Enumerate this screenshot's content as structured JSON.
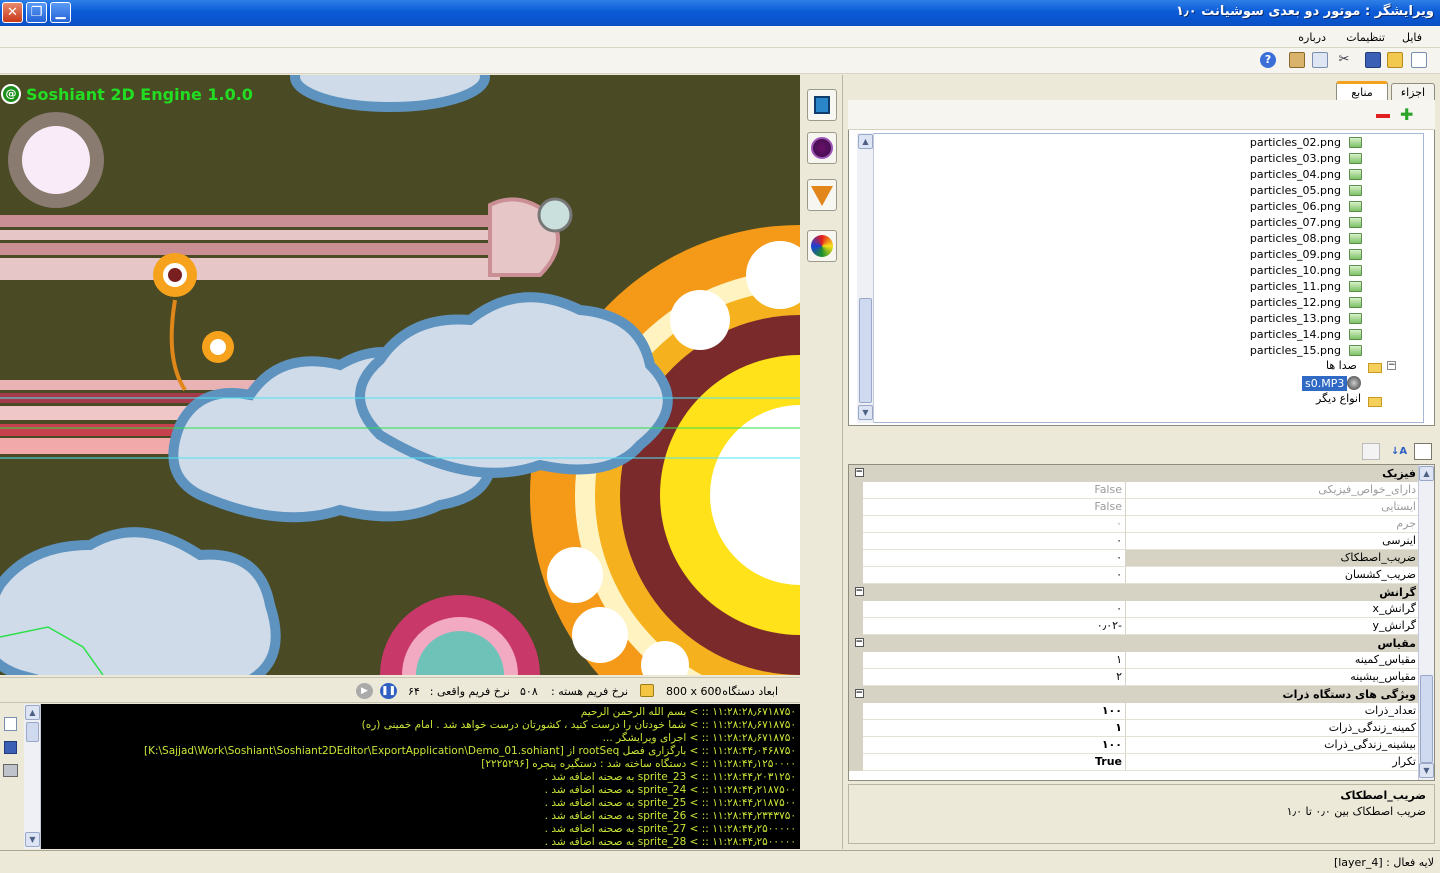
{
  "window": {
    "title": "ویرایشگر : موتور دو بعدی سوشیانت ۱٫۰",
    "close": "✕",
    "restore": "❐",
    "minimize": "▁"
  },
  "menu": {
    "items": [
      "فایل",
      "تنظیمات",
      "درباره"
    ]
  },
  "toolbar": {
    "icons": [
      "new-file-icon",
      "open-folder-icon",
      "save-icon",
      "cut-icon",
      "copy-icon",
      "paste-icon",
      "help-icon"
    ]
  },
  "viewport": {
    "engine_label": "Soshiant 2D Engine 1.0.0",
    "engine_badge": "@"
  },
  "viewport_status": {
    "device_dims_label": "ابعاد دستگاه :",
    "device_dims_value": "800 x 600",
    "core_rate_label": "نرخ فریم هسته :",
    "core_rate_value": "۵۰۸",
    "real_rate_label": "نرخ فریم واقعی :",
    "real_rate_value": "۶۴"
  },
  "console": {
    "lines": [
      {
        "ts": "۱۱:۲۸:۲۸٫۶۷۱۸۷۵۰",
        "msg": ":: > بسم الله الرحمن الرحیم"
      },
      {
        "ts": "۱۱:۲۸:۲۸٫۶۷۱۸۷۵۰",
        "msg": ":: > شما خودتان را درست کنید ، کشورتان درست خواهد شد . امام خمینی (ره)"
      },
      {
        "ts": "۱۱:۲۸:۲۸٫۶۷۱۸۷۵۰",
        "msg": ":: > اجرای ویرایشگر ..."
      },
      {
        "ts": "۱۱:۲۸:۴۴٫۰۴۶۸۷۵۰",
        "msg": ":: > بارگزاری فصل rootSeq از [K:\\Sajjad\\Work\\Soshiant\\Soshiant2DEditor\\ExportApplication\\Demo_01.sohiant]"
      },
      {
        "ts": "۱۱:۲۸:۴۴٫۱۲۵۰۰۰۰",
        "msg": ":: > دستگاه ساخته شد : دستگیره پنجره [۲۲۲۵۲۹۶]"
      },
      {
        "ts": "۱۱:۲۸:۴۴٫۲۰۳۱۲۵۰",
        "msg": ":: > sprite_23  به صحنه اضافه شد ."
      },
      {
        "ts": "۱۱:۲۸:۴۴٫۲۱۸۷۵۰۰",
        "msg": ":: > sprite_24  به صحنه اضافه شد ."
      },
      {
        "ts": "۱۱:۲۸:۴۴٫۲۱۸۷۵۰۰",
        "msg": ":: > sprite_25  به صحنه اضافه شد ."
      },
      {
        "ts": "۱۱:۲۸:۴۴٫۲۳۴۳۷۵۰",
        "msg": ":: > sprite_26  به صحنه اضافه شد ."
      },
      {
        "ts": "۱۱:۲۸:۴۴٫۲۵۰۰۰۰۰",
        "msg": ":: > sprite_27  به صحنه اضافه شد ."
      },
      {
        "ts": "۱۱:۲۸:۴۴٫۲۵۰۰۰۰۰",
        "msg": ":: > sprite_28  به صحنه اضافه شد ."
      }
    ]
  },
  "right_panel": {
    "tabs": [
      "اجزاء",
      "منابع"
    ],
    "tree": {
      "files": [
        "particles_02.png",
        "particles_03.png",
        "particles_04.png",
        "particles_05.png",
        "particles_06.png",
        "particles_07.png",
        "particles_08.png",
        "particles_09.png",
        "particles_10.png",
        "particles_11.png",
        "particles_12.png",
        "particles_13.png",
        "particles_14.png",
        "particles_15.png"
      ],
      "sounds_folder": "صدا ها",
      "sound_file": "s0.MP3",
      "others_folder": "انواع دیگر"
    },
    "properties": {
      "cat_physics": "فیزیک",
      "cat_gravity": "گرانش",
      "cat_scale": "مقیاس",
      "cat_emitter": "ویژگی های دستگاه ذرات",
      "rows": {
        "has_physics": {
          "name": "دارای_خواص_فیزیکی",
          "value": "False"
        },
        "static": {
          "name": "ایستایی",
          "value": "False"
        },
        "mass": {
          "name": "جرم",
          "value": "۰"
        },
        "inertia": {
          "name": "اینرسی",
          "value": "۰"
        },
        "friction": {
          "name": "ضریب_اصطکاک",
          "value": "۰"
        },
        "restitution": {
          "name": "ضریب_کشسان",
          "value": "۰"
        },
        "gravity_x": {
          "name": "گرانش_x",
          "value": "۰"
        },
        "gravity_y": {
          "name": "گرانش_y",
          "value": "-۰٫۰۲"
        },
        "scale_min": {
          "name": "مقیاس_کمینه",
          "value": "۱"
        },
        "scale_max": {
          "name": "مقیاس_بیشینه",
          "value": "۲"
        },
        "count": {
          "name": "تعداد_ذرات",
          "value": "۱۰۰"
        },
        "life_min": {
          "name": "کمینه_زندگی_ذرات",
          "value": "۱"
        },
        "life_max": {
          "name": "بیشینه_زندگی_ذرات",
          "value": "۱۰۰"
        },
        "repeat": {
          "name": "تکرار",
          "value": "True"
        }
      }
    },
    "description": {
      "title": "ضریب_اصطکاک",
      "text": "ضریب اصطکاک بین ۰٫۰ تا ۱٫۰"
    }
  },
  "statusbar": {
    "text": "لایه فعال : [layer_4]"
  }
}
